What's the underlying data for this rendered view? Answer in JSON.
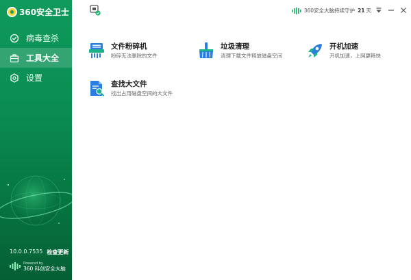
{
  "app": {
    "logo_text": "360安全卫士",
    "version": "10.0.0.7535",
    "check_update": "检查更新",
    "powered_by": "Powered by",
    "powered_brand": "360 科创安全大脑"
  },
  "sidebar": {
    "items": [
      {
        "label": "病毒查杀",
        "icon": "shield-scan-icon",
        "active": false
      },
      {
        "label": "工具大全",
        "icon": "toolbox-icon",
        "active": true
      },
      {
        "label": "设置",
        "icon": "gear-icon",
        "active": false
      }
    ]
  },
  "topbar": {
    "protect_prefix": "360安全大脑持续守护",
    "protect_days": "21",
    "protect_suffix": "天"
  },
  "tools": [
    {
      "title": "文件粉碎机",
      "desc": "粉碎无法删除的文件",
      "icon": "shredder-icon"
    },
    {
      "title": "垃圾清理",
      "desc": "清理下载文件释放磁盘空间",
      "icon": "broom-icon"
    },
    {
      "title": "开机加速",
      "desc": "开机加速，上网更畅快",
      "icon": "rocket-icon"
    },
    {
      "title": "查找大文件",
      "desc": "找出占用磁盘空间的大文件",
      "icon": "file-search-icon"
    }
  ],
  "colors": {
    "brand_green": "#0f9a5c",
    "accent_blue": "#2c7fe0",
    "accent_teal": "#1bb38a"
  }
}
